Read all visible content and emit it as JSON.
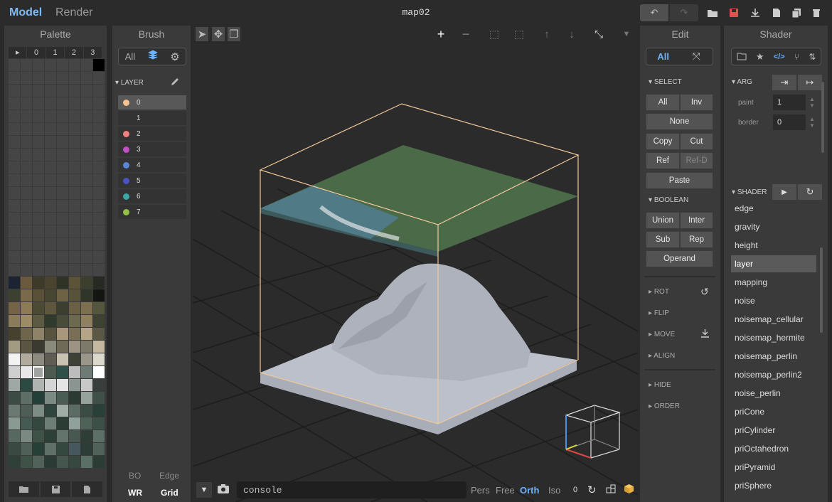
{
  "topbar": {
    "model": "Model",
    "render": "Render",
    "filename": "map02"
  },
  "palette": {
    "title": "Palette",
    "header": [
      "▸",
      "0",
      "1",
      "2",
      "3"
    ],
    "rows": [
      [
        "#454545",
        "#454545",
        "#454545",
        "#454545",
        "#454545",
        "#454545",
        "#454545",
        "#000000"
      ],
      [
        "#454545",
        "#454545",
        "#454545",
        "#454545",
        "#454545",
        "#454545",
        "#454545",
        "#454545"
      ],
      [
        "#454545",
        "#454545",
        "#454545",
        "#454545",
        "#454545",
        "#454545",
        "#454545",
        "#454545"
      ],
      [
        "#454545",
        "#454545",
        "#454545",
        "#454545",
        "#454545",
        "#454545",
        "#454545",
        "#454545"
      ],
      [
        "#454545",
        "#454545",
        "#454545",
        "#454545",
        "#454545",
        "#454545",
        "#454545",
        "#454545"
      ],
      [
        "#454545",
        "#454545",
        "#454545",
        "#454545",
        "#454545",
        "#454545",
        "#454545",
        "#454545"
      ],
      [
        "#454545",
        "#454545",
        "#454545",
        "#454545",
        "#454545",
        "#454545",
        "#454545",
        "#454545"
      ],
      [
        "#454545",
        "#454545",
        "#454545",
        "#454545",
        "#454545",
        "#454545",
        "#454545",
        "#454545"
      ],
      [
        "#454545",
        "#454545",
        "#454545",
        "#454545",
        "#454545",
        "#454545",
        "#454545",
        "#454545"
      ],
      [
        "#454545",
        "#454545",
        "#454545",
        "#454545",
        "#454545",
        "#454545",
        "#454545",
        "#454545"
      ],
      [
        "#454545",
        "#454545",
        "#454545",
        "#454545",
        "#454545",
        "#454545",
        "#454545",
        "#454545"
      ],
      [
        "#454545",
        "#454545",
        "#454545",
        "#454545",
        "#454545",
        "#454545",
        "#454545",
        "#454545"
      ],
      [
        "#454545",
        "#454545",
        "#454545",
        "#454545",
        "#454545",
        "#454545",
        "#454545",
        "#454545"
      ],
      [
        "#454545",
        "#454545",
        "#454545",
        "#454545",
        "#454545",
        "#454545",
        "#454545",
        "#454545"
      ],
      [
        "#454545",
        "#454545",
        "#454545",
        "#454545",
        "#454545",
        "#454545",
        "#454545",
        "#454545"
      ],
      [
        "#454545",
        "#454545",
        "#454545",
        "#454545",
        "#454545",
        "#454545",
        "#454545",
        "#454545"
      ],
      [
        "#454545",
        "#454545",
        "#454545",
        "#454545",
        "#454545",
        "#454545",
        "#454545",
        "#454545"
      ],
      [
        "#1c2433",
        "#6b5a3e",
        "#3d3a2a",
        "#4a4330",
        "#2e3326",
        "#5c5236",
        "#3c3e2e",
        "#262a22"
      ],
      [
        "#3b4030",
        "#7a6a4a",
        "#5a5038",
        "#474632",
        "#6e6244",
        "#585338",
        "#2f3528",
        "#121510"
      ],
      [
        "#746445",
        "#8c7b55",
        "#4b4a35",
        "#5e573e",
        "#3c3f2f",
        "#6b6044",
        "#7d7050",
        "#55563e"
      ],
      [
        "#8a7c5a",
        "#9c8c66",
        "#5d5a44",
        "#2f3a2c",
        "#4a4c3a",
        "#6b6a4f",
        "#8f8060",
        "#3d4233"
      ],
      [
        "#46402f",
        "#6e654a",
        "#8e8366",
        "#57533e",
        "#a8977a",
        "#7a6f55",
        "#b5a586",
        "#5a5845"
      ],
      [
        "#a39a82",
        "#5a5442",
        "#3a3a30",
        "#8a8a7a",
        "#6f6a58",
        "#9d9382",
        "#7e7a6a",
        "#c4b9a0"
      ],
      [
        "#f2f2f2",
        "#b0ab9c",
        "#8d8a80",
        "#5e5c53",
        "#c7c2b2",
        "#3d4034",
        "#9a968a",
        "#dcd8cc"
      ],
      [
        "#cfcfcf",
        "#e8e8e8",
        "#a0a4a0",
        "#4c5a50",
        "#2e5048",
        "#bcbcbc",
        "#6e7a74",
        "#ffffff"
      ],
      [
        "#9ea8a4",
        "#2a4a42",
        "#b0b4b0",
        "#d4d4d4",
        "#e4e4e4",
        "#8a9490",
        "#c8c8c8",
        "#383e3c"
      ],
      [
        "#3c4c44",
        "#5c6e66",
        "#224038",
        "#7c8a84",
        "#4a5c54",
        "#2c3a34",
        "#96a29c",
        "#3e5048"
      ],
      [
        "#6a7a72",
        "#4e5e56",
        "#7e8c86",
        "#2e443c",
        "#a0aca6",
        "#5a6c64",
        "#3a4c44",
        "#284038"
      ],
      [
        "#8a9a92",
        "#445a52",
        "#34483f",
        "#6c7e76",
        "#2a3c34",
        "#90a09a",
        "#4e6258",
        "#3c5048"
      ],
      [
        "#56685f",
        "#7a8a82",
        "#3e5248",
        "#2c4038",
        "#62746c",
        "#46584f",
        "#2e3e36",
        "#5c7068"
      ],
      [
        "#3a4a42",
        "#4e6058",
        "#264038",
        "#5e7068",
        "#344840",
        "#46585e",
        "#2c3c36",
        "#506259"
      ],
      [
        "#2e4038",
        "#3e5248",
        "#50625a",
        "#2a3a34",
        "#44564e",
        "#36483f",
        "#587066",
        "#2a3c34"
      ]
    ]
  },
  "brush": {
    "title": "Brush",
    "filter": "All",
    "layer_label": "LAYER",
    "layers": [
      {
        "n": "0",
        "c": "#f7c28f"
      },
      {
        "n": "1",
        "c": ""
      },
      {
        "n": "2",
        "c": "#f08080"
      },
      {
        "n": "3",
        "c": "#c050c8"
      },
      {
        "n": "4",
        "c": "#5a86d8"
      },
      {
        "n": "5",
        "c": "#4a52c4"
      },
      {
        "n": "6",
        "c": "#3aa8a8"
      },
      {
        "n": "7",
        "c": "#94c048"
      }
    ],
    "bo": "BO",
    "edge": "Edge",
    "wr": "WR",
    "grid": "Grid"
  },
  "edit": {
    "title": "Edit",
    "filter": "All",
    "select": "SELECT",
    "boolean": "BOOLEAN",
    "b_all": "All",
    "b_inv": "Inv",
    "b_none": "None",
    "b_copy": "Copy",
    "b_cut": "Cut",
    "b_ref": "Ref",
    "b_refd": "Ref-D",
    "b_paste": "Paste",
    "b_union": "Union",
    "b_inter": "Inter",
    "b_sub": "Sub",
    "b_rep": "Rep",
    "b_operand": "Operand",
    "rot": "ROT",
    "flip": "FLIP",
    "move": "MOVE",
    "align": "ALIGN",
    "hide": "HIDE",
    "order": "ORDER"
  },
  "shader": {
    "title": "Shader",
    "arg": "ARG",
    "paint_label": "paint",
    "paint": "1",
    "border_label": "border",
    "border": "0",
    "shader_label": "SHADER",
    "items": [
      "edge",
      "gravity",
      "height",
      "layer",
      "mapping",
      "noise",
      "noisemap_cellular",
      "noisemap_hermite",
      "noisemap_perlin",
      "noisemap_perlin2",
      "noise_perlin",
      "priCone",
      "priCylinder",
      "priOctahedron",
      "priPyramid",
      "priSphere"
    ]
  },
  "viewport": {
    "console": "console",
    "pers": "Pers",
    "free": "Free",
    "orth": "Orth",
    "iso": "Iso",
    "zero": "0"
  },
  "colors": {
    "accent": "#6fb2ff",
    "record": "#e05050",
    "box": "#f2c89a"
  }
}
